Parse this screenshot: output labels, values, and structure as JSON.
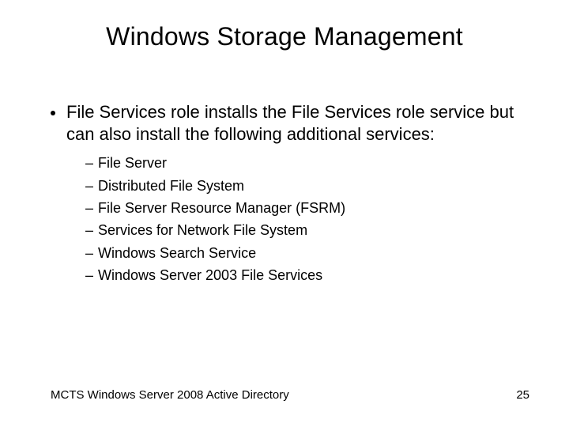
{
  "title": "Windows Storage Management",
  "bullet": "File Services role installs the File Services role service but can also install the following additional services:",
  "subitems": [
    "File Server",
    "Distributed File System",
    "File Server Resource Manager (FSRM)",
    "Services for Network File System",
    "Windows Search Service",
    "Windows Server 2003 File Services"
  ],
  "footer_left": "MCTS Windows Server 2008 Active Directory",
  "footer_right": "25",
  "dash": "–"
}
